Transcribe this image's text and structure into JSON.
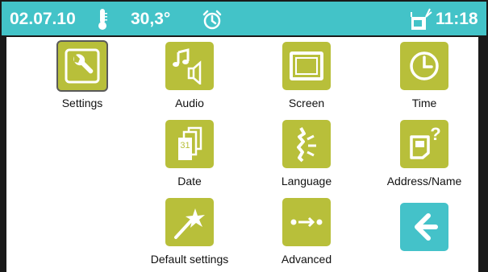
{
  "status": {
    "date": "02.07.10",
    "thermometer_icon": "thermometer-icon",
    "temperature": "30,3°",
    "alarm_icon": "alarm-clock-icon",
    "message_icon": "mailbox-icon",
    "time": "11:18"
  },
  "menu": {
    "settings": "Settings",
    "audio": "Audio",
    "screen": "Screen",
    "time": "Time",
    "date": "Date",
    "date_day": "31",
    "language": "Language",
    "address": "Address/Name",
    "default": "Default settings",
    "advanced": "Advanced"
  },
  "colors": {
    "accent": "#43c3c8",
    "tile": "#b8bf3a",
    "back_tile": "#44c2c9"
  }
}
